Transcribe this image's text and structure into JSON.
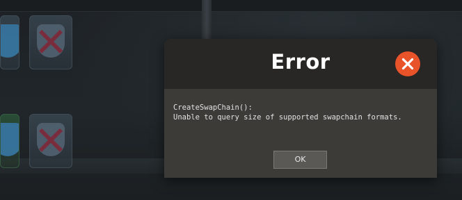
{
  "dialog": {
    "title": "Error",
    "message_lines": [
      "CreateSwapChain():",
      "Unable to query size of supported swapchain formats."
    ],
    "ok_label": "OK",
    "close_icon": "close-icon",
    "accent_color": "#e8532a"
  }
}
